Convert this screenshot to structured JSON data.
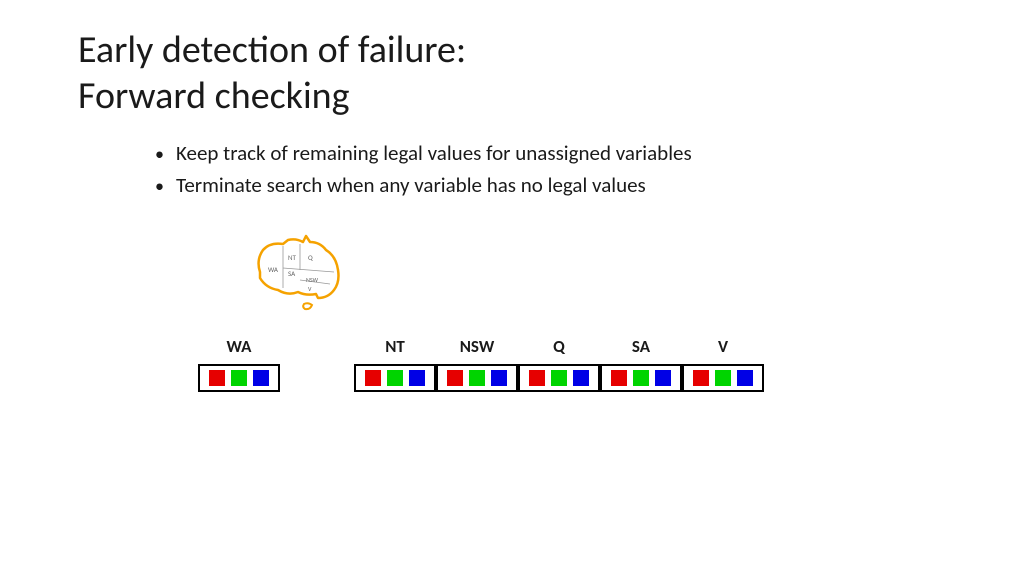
{
  "title_line1": "Early detection of failure:",
  "title_line2": "Forward checking",
  "bullets": [
    "Keep track of remaining legal values for unassigned variables",
    "Terminate search when any variable has no legal values"
  ],
  "map_regions": {
    "wa": "WA",
    "nt": "NT",
    "q": "Q",
    "sa": "SA",
    "nsw": "NSW",
    "v": "V"
  },
  "columns": [
    {
      "label": "WA",
      "colors": [
        "r",
        "g",
        "b"
      ],
      "width": 82
    },
    {
      "label": "",
      "gap": true
    },
    {
      "label": "NT",
      "colors": [
        "r",
        "g",
        "b"
      ],
      "width": 82
    },
    {
      "label": "NSW",
      "colors": [
        "r",
        "g",
        "b"
      ],
      "width": 82
    },
    {
      "label": "Q",
      "colors": [
        "r",
        "g",
        "b"
      ],
      "width": 82
    },
    {
      "label": "SA",
      "colors": [
        "r",
        "g",
        "b"
      ],
      "width": 82
    },
    {
      "label": "V",
      "colors": [
        "r",
        "g",
        "b"
      ],
      "width": 82
    }
  ],
  "colors": {
    "r": "#e60000",
    "g": "#00d400",
    "b": "#0000e6",
    "outline": "#f5a200"
  }
}
